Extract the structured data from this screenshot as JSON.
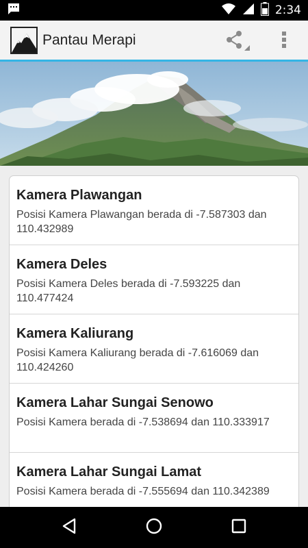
{
  "status_bar": {
    "time": "2:34",
    "icons": [
      "chat-notification-icon",
      "wifi-icon",
      "signal-icon",
      "battery-icon"
    ]
  },
  "app_bar": {
    "title": "Pantau Merapi",
    "icons": [
      "mountain-logo-icon",
      "share-icon",
      "overflow-menu-icon"
    ],
    "accent_color": "#33b5e5"
  },
  "cameras": [
    {
      "title": "Kamera Plawangan",
      "description": "Posisi Kamera Plawangan berada di -7.587303 dan 110.432989"
    },
    {
      "title": "Kamera Deles",
      "description": "Posisi Kamera Deles berada di -7.593225 dan 110.477424"
    },
    {
      "title": "Kamera Kaliurang",
      "description": "Posisi Kamera Kaliurang berada di -7.616069 dan 110.424260"
    },
    {
      "title": "Kamera Lahar Sungai Senowo",
      "description": "Posisi Kamera berada di -7.538694 dan 110.333917"
    },
    {
      "title": "Kamera Lahar Sungai Lamat",
      "description": "Posisi Kamera berada di -7.555694 dan 110.342389"
    }
  ],
  "nav_bar": {
    "icons": [
      "back-icon",
      "home-icon",
      "recents-icon"
    ]
  }
}
